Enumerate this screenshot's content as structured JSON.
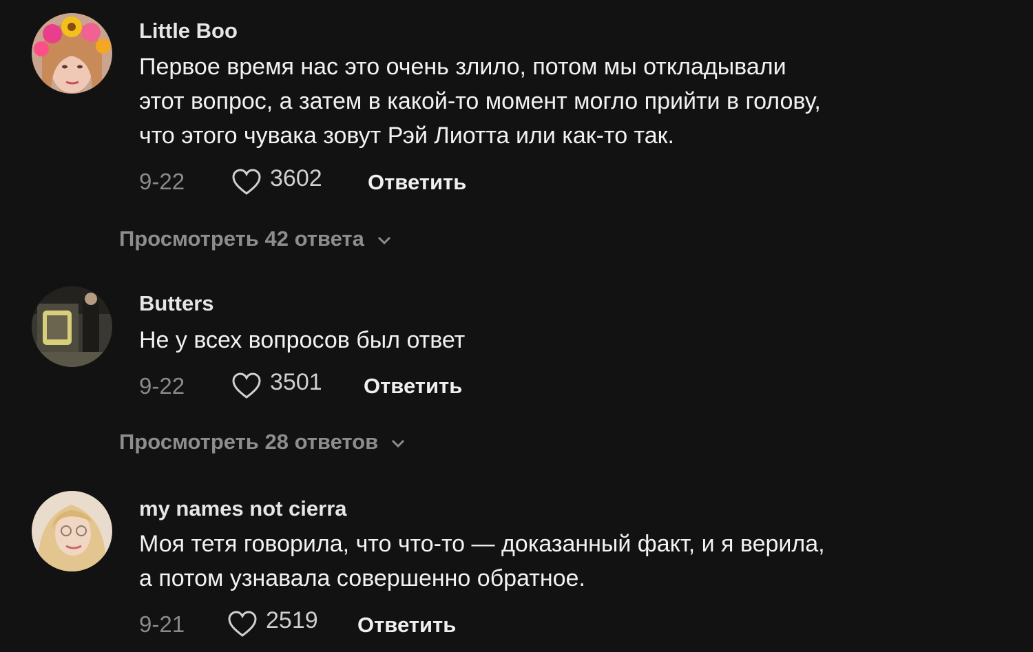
{
  "comments": [
    {
      "username": "Little Boo",
      "lines": [
        "Первое время нас это очень злило, потом мы откладывали",
        "этот вопрос, а затем в какой-то момент могло прийти в голову,",
        "что этого чувака зовут Рэй Лиотта или как-то так."
      ],
      "date": "9-22",
      "likes": "3602",
      "reply_label": "Ответить",
      "view_replies": "Просмотреть 42 ответа",
      "avatar_icon": "avatar-flower-crown"
    },
    {
      "username": "Butters",
      "lines": [
        "Не у всех вопросов был ответ"
      ],
      "date": "9-22",
      "likes": "3501",
      "reply_label": "Ответить",
      "view_replies": "Просмотреть 28 ответов",
      "avatar_icon": "avatar-photo"
    },
    {
      "username": "my names not cierra",
      "lines": [
        "Моя тетя говорила, что что-то — доказанный факт, и я верила,",
        "а потом узнавала совершенно обратное."
      ],
      "date": "9-21",
      "likes": "2519",
      "reply_label": "Ответить",
      "avatar_icon": "avatar-blonde"
    }
  ],
  "icons": {
    "like": "heart-outline-icon",
    "expand": "chevron-down-icon"
  },
  "colors": {
    "background": "#121212",
    "username": "#e6e6e6",
    "text": "#f2f2f2",
    "muted": "#8a8a8a"
  }
}
